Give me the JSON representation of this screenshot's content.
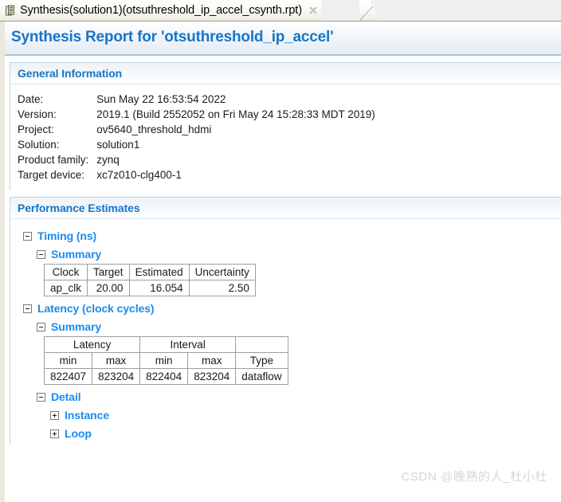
{
  "tab": {
    "title": "Synthesis(solution1)(otsuthreshold_ip_accel_csynth.rpt)",
    "icon": "report-document-icon",
    "close_icon": "close-icon"
  },
  "report": {
    "title": "Synthesis Report for 'otsuthreshold_ip_accel'"
  },
  "general_information": {
    "header": "General Information",
    "rows": [
      {
        "key": "Date:",
        "value": "Sun May 22 16:53:54 2022"
      },
      {
        "key": "Version:",
        "value": "2019.1 (Build 2552052 on Fri May 24 15:28:33 MDT 2019)"
      },
      {
        "key": "Project:",
        "value": "ov5640_threshold_hdmi"
      },
      {
        "key": "Solution:",
        "value": "solution1"
      },
      {
        "key": "Product family:",
        "value": "zynq"
      },
      {
        "key": "Target device:",
        "value": "xc7z010-clg400-1"
      }
    ]
  },
  "performance_estimates": {
    "header": "Performance Estimates",
    "timing": {
      "label": "Timing (ns)",
      "summary_label": "Summary",
      "headers": [
        "Clock",
        "Target",
        "Estimated",
        "Uncertainty"
      ],
      "rows": [
        {
          "clock": "ap_clk",
          "target": "20.00",
          "estimated": "16.054",
          "uncertainty": "2.50"
        }
      ]
    },
    "latency": {
      "label": "Latency (clock cycles)",
      "summary_label": "Summary",
      "group_headers": [
        "Latency",
        "Interval",
        ""
      ],
      "sub_headers": [
        "min",
        "max",
        "min",
        "max",
        "Type"
      ],
      "rows": [
        {
          "latency_min": "822407",
          "latency_max": "823204",
          "interval_min": "822404",
          "interval_max": "823204",
          "type": "dataflow"
        }
      ],
      "detail": {
        "label": "Detail",
        "items": [
          {
            "label": "Instance",
            "expanded": false
          },
          {
            "label": "Loop",
            "expanded": false
          }
        ]
      }
    }
  },
  "watermark": {
    "text": "CSDN @晚熟的人_杜小杜"
  },
  "colors": {
    "link_blue": "#1a8cf0",
    "header_blue": "#1675c8",
    "panel_border": "#c3d3e3",
    "table_border": "#9e9e9e",
    "left_strip": "#ebe9dd"
  }
}
